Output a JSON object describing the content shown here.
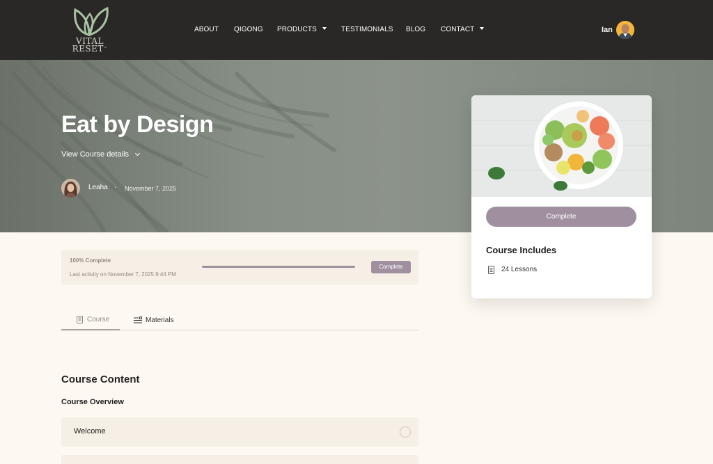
{
  "header": {
    "logo": {
      "line1": "VITAL",
      "line2": "RESET",
      "tm": "™"
    },
    "nav": [
      {
        "label": "ABOUT",
        "dropdown": false
      },
      {
        "label": "QIGONG",
        "dropdown": false
      },
      {
        "label": "PRODUCTS",
        "dropdown": true
      },
      {
        "label": "TESTIMONIALS",
        "dropdown": false
      },
      {
        "label": "BLOG",
        "dropdown": false
      },
      {
        "label": "CONTACT",
        "dropdown": true
      }
    ],
    "user_name": "Ian"
  },
  "hero": {
    "title": "Eat by Design",
    "details_link": "View Course details",
    "author": "Leaha",
    "separator": "·",
    "date": "November 7, 2025"
  },
  "progress": {
    "percent_label": "100% Complete",
    "percent": 100,
    "last_activity": "Last activity on November 7, 2025 9:44 PM",
    "status_button": "Complete"
  },
  "tabs": [
    {
      "label": "Course",
      "active": true
    },
    {
      "label": "Materials",
      "active": false
    }
  ],
  "content": {
    "heading": "Course Content",
    "section_title": "Course Overview",
    "lessons": [
      {
        "label": "Welcome"
      },
      {
        "label": ""
      }
    ]
  },
  "side_card": {
    "button": "Complete",
    "includes_title": "Course Includes",
    "lessons_count": "24 Lessons"
  },
  "colors": {
    "header_bg": "#2a2826",
    "accent_mauve": "#a0909f",
    "page_bg": "#fdf8f1",
    "panel_bg": "#f6efe5"
  },
  "icons": [
    "leaf-logo-icon",
    "caret-down-icon",
    "chevron-down-icon",
    "book-icon",
    "list-icon",
    "circle-icon"
  ]
}
